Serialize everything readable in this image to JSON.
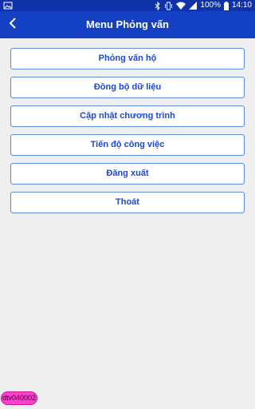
{
  "status_bar": {
    "battery_percent": "100%",
    "time": "14:10",
    "icons": [
      "image-icon",
      "bluetooth-icon",
      "vibrate-icon",
      "wifi-icon",
      "signal-icon",
      "battery-icon"
    ]
  },
  "app_bar": {
    "title": "Menu Phỏng vấn",
    "back_icon": "back-chevron-icon"
  },
  "menu": {
    "items": [
      {
        "label": "Phỏng vấn hộ"
      },
      {
        "label": "Đồng bộ dữ liệu"
      },
      {
        "label": "Cập nhật chương trình"
      },
      {
        "label": "Tiến độ công việc"
      },
      {
        "label": "Đăng xuất"
      },
      {
        "label": "Thoát"
      }
    ]
  },
  "user_badge": {
    "text": "dtv040002"
  },
  "colors": {
    "status_bar": "#0f32a8",
    "app_bar": "#1440c4",
    "background": "#efefef",
    "button_text": "#1d49cf",
    "button_border": "#5b8bd3",
    "badge": "#ff3fd0"
  }
}
